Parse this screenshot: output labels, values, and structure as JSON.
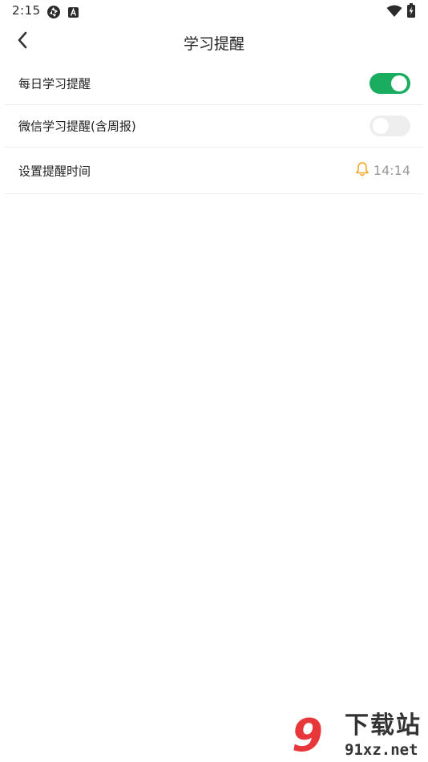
{
  "status_bar": {
    "time": "2:15",
    "left_icons": [
      "aperture-icon",
      "a-badge-icon"
    ],
    "right_icons": [
      "wifi-icon",
      "battery-charging-icon"
    ]
  },
  "header": {
    "title": "学习提醒",
    "back_icon": "chevron-left-icon"
  },
  "settings": [
    {
      "label": "每日学习提醒",
      "control": "toggle",
      "on": true
    },
    {
      "label": "微信学习提醒(含周报)",
      "control": "toggle",
      "on": false
    },
    {
      "label": "设置提醒时间",
      "control": "time",
      "icon": "bell-icon",
      "value": "14:14"
    }
  ],
  "watermark": {
    "logo_digit": "9",
    "title": "下载站",
    "domain": "91xz.net"
  },
  "colors": {
    "toggle_on": "#1aad5f",
    "toggle_off": "#eeeeee",
    "bell": "#f5a623",
    "time_text": "#999999",
    "watermark_red": "#e8373a"
  }
}
